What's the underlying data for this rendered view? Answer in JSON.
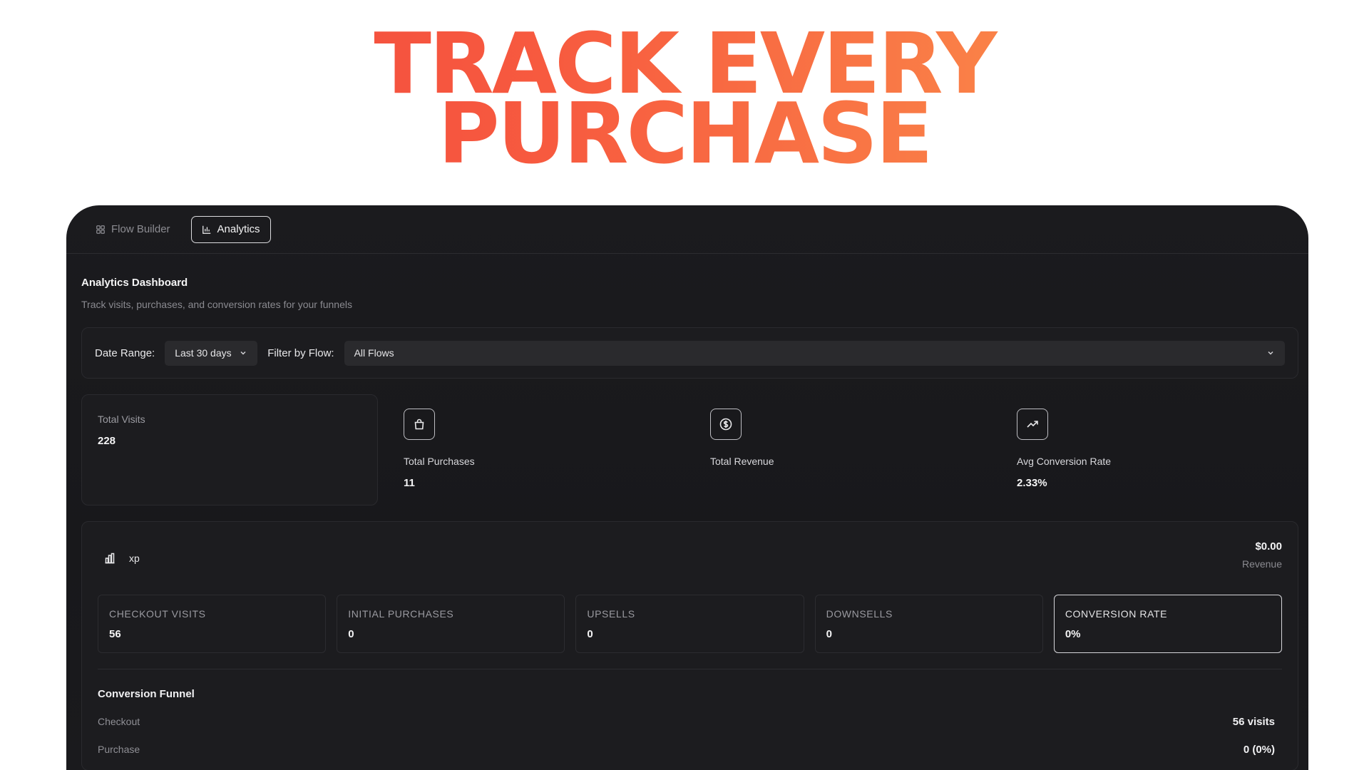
{
  "hero": {
    "line1": "TRACK EVERY",
    "line2": "PURCHASE"
  },
  "tabs": [
    {
      "label": "Flow Builder",
      "icon": "grid-icon",
      "active": false
    },
    {
      "label": "Analytics",
      "icon": "bar-chart-icon",
      "active": true
    }
  ],
  "dashboard": {
    "title": "Analytics Dashboard",
    "subtitle": "Track visits, purchases, and conversion rates for your funnels"
  },
  "filters": {
    "date_label": "Date Range:",
    "date_value": "Last 30 days",
    "flow_label": "Filter by Flow:",
    "flow_value": "All Flows"
  },
  "stats": [
    {
      "label": "Total Visits",
      "value": "228"
    },
    {
      "label": "Total Purchases",
      "value": "11",
      "icon": "shopping-bag-icon"
    },
    {
      "label": "Total Revenue",
      "value": "",
      "icon": "dollar-circle-icon"
    },
    {
      "label": "Avg Conversion Rate",
      "value": "2.33%",
      "icon": "trending-up-icon"
    }
  ],
  "flow": {
    "name": "xp",
    "icon": "bar-chart-icon",
    "revenue_value": "$0.00",
    "revenue_label": "Revenue",
    "metrics": [
      {
        "label": "CHECKOUT VISITS",
        "value": "56"
      },
      {
        "label": "INITIAL PURCHASES",
        "value": "0"
      },
      {
        "label": "UPSELLS",
        "value": "0"
      },
      {
        "label": "DOWNSELLS",
        "value": "0"
      },
      {
        "label": "CONVERSION RATE",
        "value": "0%"
      }
    ],
    "funnel_title": "Conversion Funnel",
    "funnel": [
      {
        "label": "Checkout",
        "value": "56 visits"
      },
      {
        "label": "Purchase",
        "value": "0 (0%)"
      }
    ]
  }
}
